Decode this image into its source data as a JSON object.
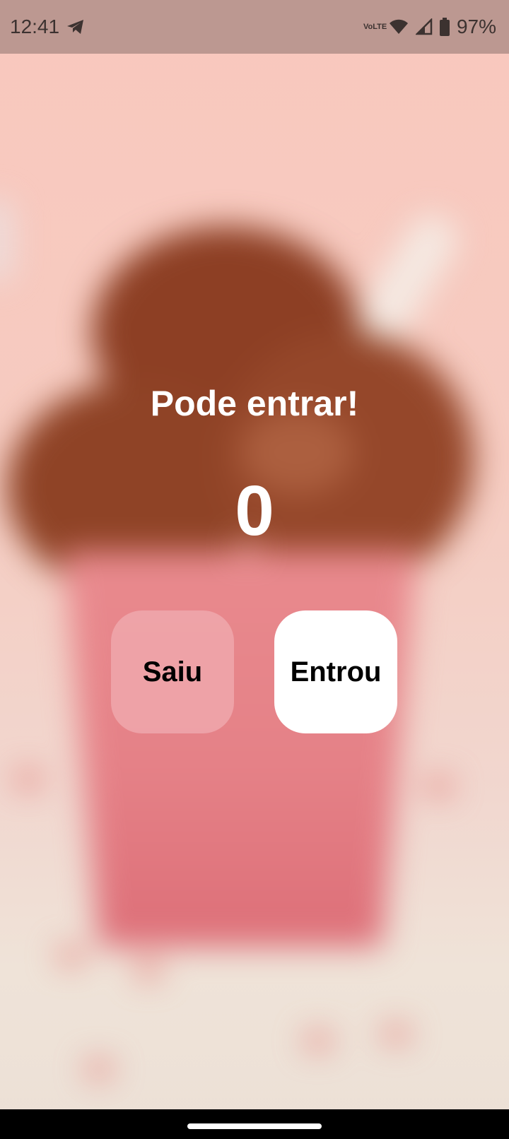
{
  "status_bar": {
    "time": "12:41",
    "volte_line1": "Vo",
    "volte_line2": "LTE",
    "battery": "97%",
    "icons": [
      "telegram-icon",
      "volte-icon",
      "wifi-icon",
      "signal-icon",
      "battery-icon"
    ]
  },
  "main": {
    "title": "Pode entrar!",
    "counter": "0",
    "exit_button_label": "Saiu",
    "enter_button_label": "Entrou"
  },
  "colors": {
    "status_bar_bg": "#bc9891",
    "text": "#ffffff",
    "enter_button_bg": "#ffffff",
    "exit_button_bg": "#eda6ab"
  }
}
